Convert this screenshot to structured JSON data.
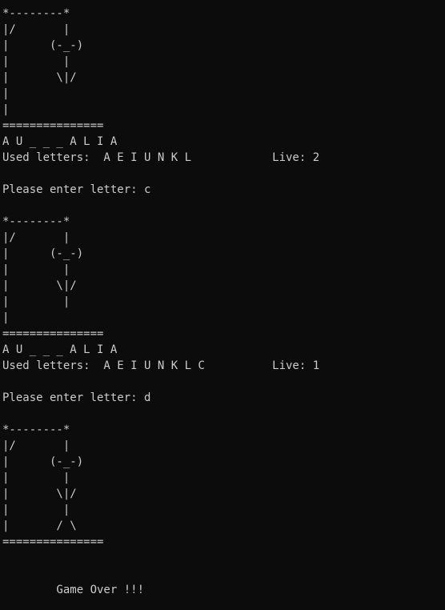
{
  "console": {
    "lines": [
      "*--------*",
      "|/       |",
      "|      (-_-)",
      "|        |",
      "|       \\|/",
      "|",
      "|",
      "===============",
      "A U _ _ _ A L I A",
      "Used letters:  A E I U N K L            Live: 2",
      "",
      "Please enter letter: c",
      "",
      "*--------*",
      "|/       |",
      "|      (-_-)",
      "|        |",
      "|       \\|/",
      "|        |",
      "|",
      "===============",
      "A U _ _ _ A L I A",
      "Used letters:  A E I U N K L C          Live: 1",
      "",
      "Please enter letter: d",
      "",
      "*--------*",
      "|/       |",
      "|      (-_-)",
      "|        |",
      "|       \\|/",
      "|        |",
      "|       / \\",
      "===============",
      "",
      "",
      "        Game Over !!!"
    ]
  }
}
